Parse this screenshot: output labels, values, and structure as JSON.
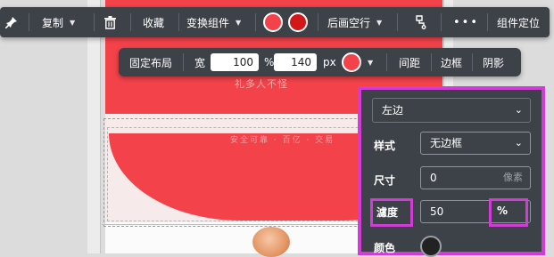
{
  "toolbar": {
    "copy": "复制",
    "collect": "收藏",
    "swap": "变换组件",
    "colors": [
      "#f4424a",
      "#d21818"
    ],
    "paragraph": "后画空行",
    "locate": "组件定位",
    "more": "•••"
  },
  "layout_bar": {
    "mode": "固定布局",
    "width_label": "宽",
    "width_value": "100",
    "width_unit": "%",
    "height_value": "140",
    "height_unit": "px",
    "color": "#f4424a",
    "spacing": "间距",
    "border": "边框",
    "shadow": "阴影"
  },
  "background": {
    "line2": "礼多人不怪",
    "faint": "安全可靠 · 百亿 · 交易"
  },
  "border_panel": {
    "side_select": "左边",
    "style_label": "样式",
    "style_value": "无边框",
    "size_label": "尺寸",
    "size_value": "0",
    "size_unit": "像素",
    "degree_label": "濾度",
    "degree_value": "50",
    "degree_unit": "%",
    "color_label": "颜色",
    "color_value": "#222222",
    "highlight": "#d23cd6"
  }
}
